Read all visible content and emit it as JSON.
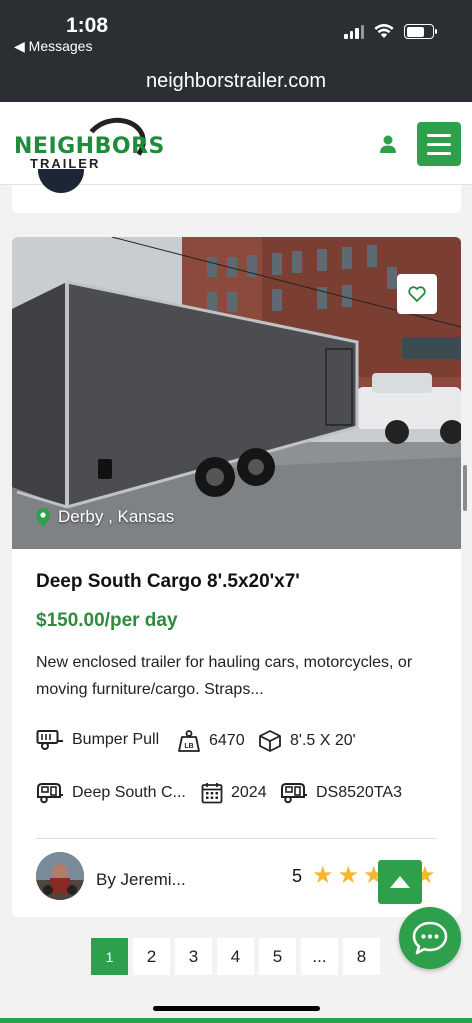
{
  "status_bar": {
    "time": "1:08",
    "back_label": "◀ Messages"
  },
  "browser": {
    "url": "neighborstrailer.com"
  },
  "header": {
    "logo_line1": "NEIGHBORS",
    "logo_line2": "TRAILER"
  },
  "listing": {
    "location": "Derby , Kansas",
    "title": "Deep South Cargo 8'.5x20'x7'",
    "price": "$150.00/per day",
    "description": "New enclosed trailer for hauling cars, motorcycles, or moving furniture/cargo. Straps...",
    "specs": {
      "hitch": "Bumper Pull",
      "weight": "6470",
      "size": "8'.5 X 20'",
      "make": "Deep South C...",
      "year": "2024",
      "model": "DS8520TA3"
    },
    "owner": "By Jeremi...",
    "rating": "5",
    "stars": 5
  },
  "pagination": [
    "1",
    "2",
    "3",
    "4",
    "5",
    "...",
    "8"
  ],
  "colors": {
    "accent": "#2e9f4b",
    "price": "#2e8b3e",
    "star": "#f5b731",
    "topbar": "#2b2f33"
  },
  "icons": [
    "user-icon",
    "hamburger-icon",
    "heart-icon",
    "map-pin-icon",
    "trailer-icon",
    "weight-icon",
    "box-icon",
    "camper-icon",
    "calendar-icon",
    "star-icon",
    "chevron-up-icon",
    "chat-bubble-icon"
  ]
}
